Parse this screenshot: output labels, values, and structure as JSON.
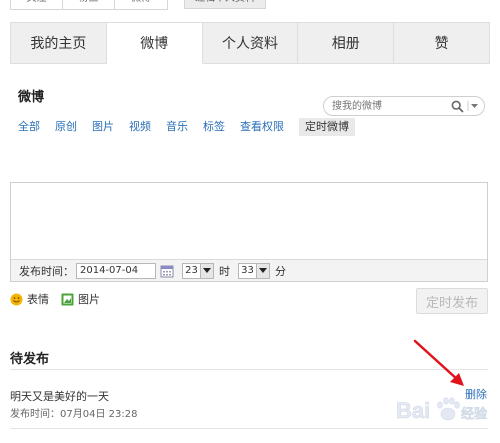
{
  "top": {
    "segments": [
      "关注",
      "粉丝",
      "微博"
    ],
    "edit_profile": "编辑个人资料"
  },
  "tabs": [
    "我的主页",
    "微博",
    "个人资料",
    "相册",
    "赞"
  ],
  "active_tab": "微博",
  "weibo": {
    "title": "微博",
    "search_placeholder": "搜我的微博",
    "filters": [
      "全部",
      "原创",
      "图片",
      "视频",
      "音乐",
      "标签",
      "查看权限",
      "定时微博"
    ]
  },
  "schedule": {
    "label": "发布时间：",
    "date": "2014-07-04",
    "hour": "23",
    "hour_unit": "时",
    "minute": "33",
    "minute_unit": "分"
  },
  "tools": {
    "emoji": "表情",
    "image": "图片"
  },
  "publish_button": "定时发布",
  "pending": {
    "title": "待发布",
    "post_text": "明天又是美好的一天",
    "post_time": "发布时间：07月04日 23:28",
    "delete": "删除"
  },
  "watermark": "Bai 经验",
  "colors": {
    "link": "#2b6fb6",
    "arrow": "#e0121b",
    "disabled_text": "#b9b9b9"
  }
}
